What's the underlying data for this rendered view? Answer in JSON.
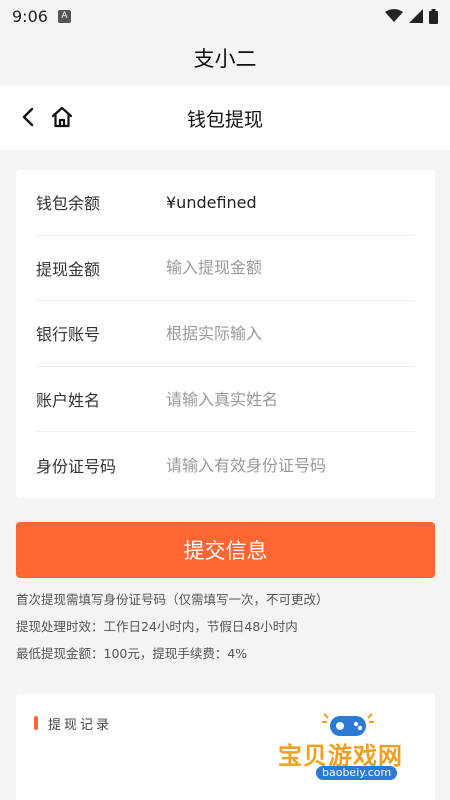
{
  "status_bar": {
    "time": "9:06",
    "notif_label": "A"
  },
  "app": {
    "title": "支小二"
  },
  "nav": {
    "title": "钱包提现"
  },
  "form": {
    "balance_label": "钱包余额",
    "balance_value": "¥undefined",
    "amount_label": "提现金额",
    "amount_placeholder": "输入提现金额",
    "bank_label": "银行账号",
    "bank_placeholder": "根据实际输入",
    "name_label": "账户姓名",
    "name_placeholder": "请输入真实姓名",
    "id_label": "身份证号码",
    "id_placeholder": "请输入有效身份证号码"
  },
  "submit": {
    "label": "提交信息"
  },
  "notes": [
    "首次提现需填写身份证号码（仅需填写一次，不可更改）",
    "提现处理时效：工作日24小时内，节假日48小时内",
    "最低提现金额：100元，提现手续费：4%"
  ],
  "records": {
    "title": "提现记录"
  },
  "watermark": {
    "text": "宝贝游戏网",
    "url": "baobeiy.com"
  },
  "colors": {
    "accent": "#ff6633",
    "background": "#f4f4f5"
  }
}
